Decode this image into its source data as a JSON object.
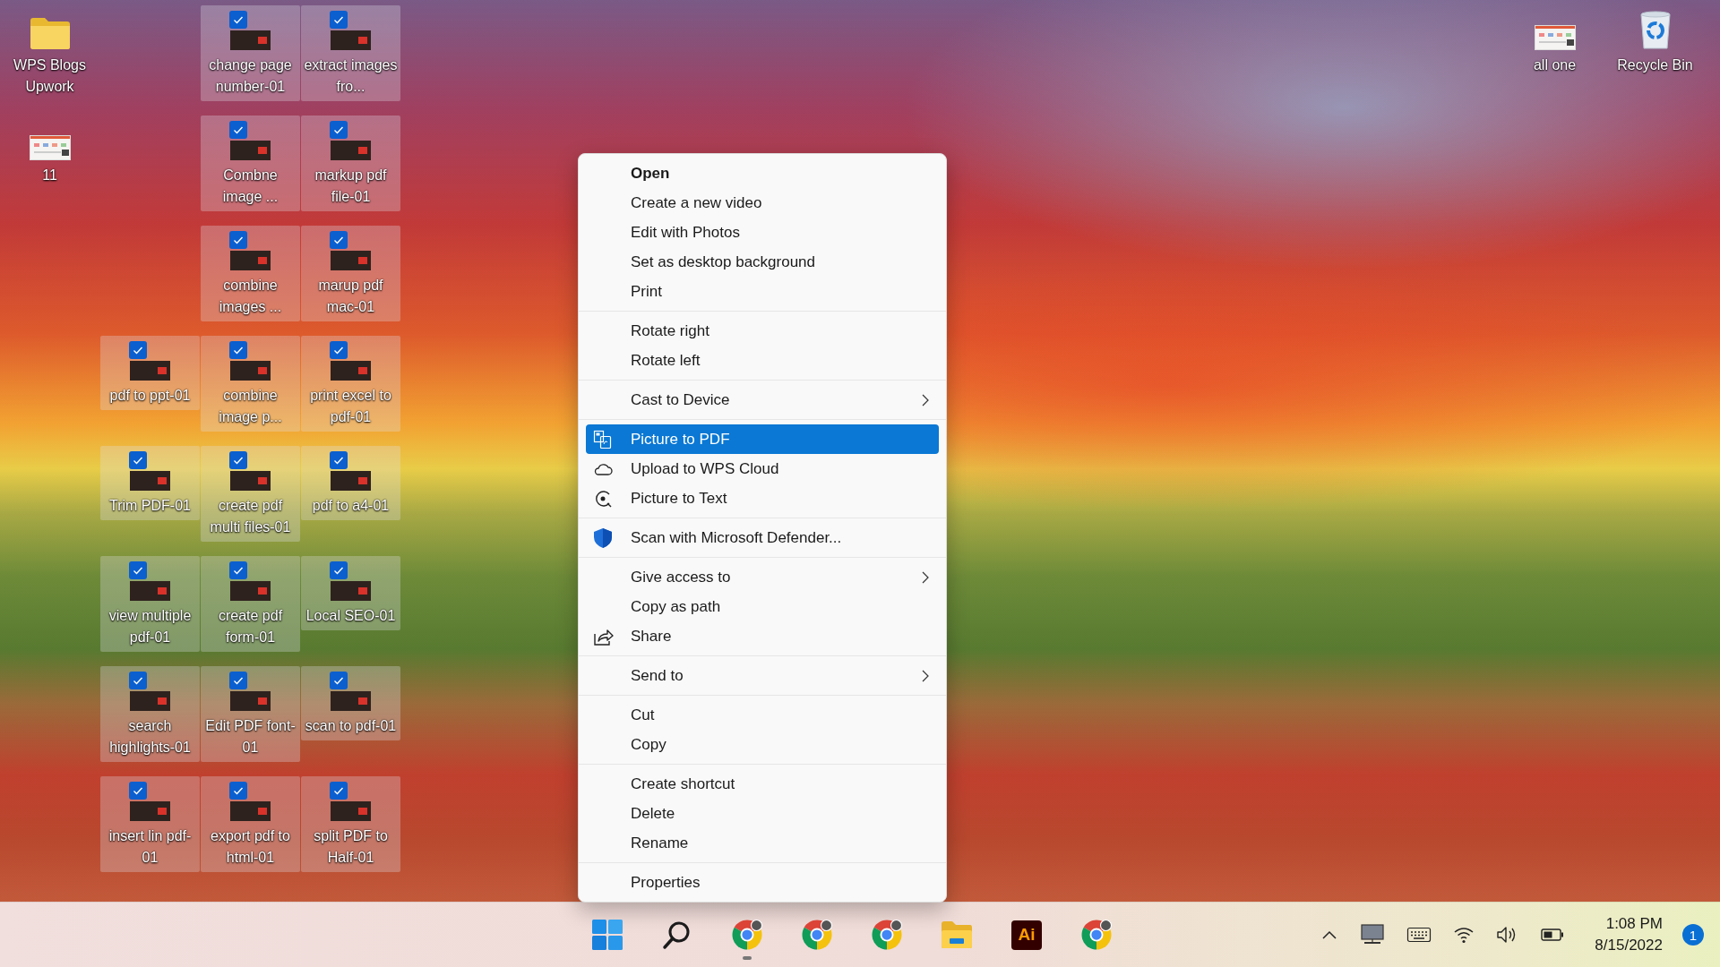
{
  "desktop": {
    "left_column": [
      {
        "label": "WPS Blogs Upwork",
        "kind": "folder",
        "selected": false
      },
      {
        "label": "11",
        "kind": "screenshot",
        "selected": false
      }
    ],
    "columns": [
      [
        {
          "label": "pdf to ppt-01",
          "kind": "image",
          "selected": true
        },
        {
          "label": "Trim PDF-01",
          "kind": "image",
          "selected": true
        },
        {
          "label": "view multiple pdf-01",
          "kind": "image",
          "selected": true
        },
        {
          "label": "search highlights-01",
          "kind": "image",
          "selected": true
        },
        {
          "label": "insert lin pdf-01",
          "kind": "image",
          "selected": true
        }
      ],
      [
        {
          "label": "change page number-01",
          "kind": "image",
          "selected": true
        },
        {
          "label": "Combne image ...",
          "kind": "image",
          "selected": true
        },
        {
          "label": "combine images ...",
          "kind": "image",
          "selected": true
        },
        {
          "label": "combine image p...",
          "kind": "image",
          "selected": true
        },
        {
          "label": "create pdf multi files-01",
          "kind": "image",
          "selected": true
        },
        {
          "label": "create pdf form-01",
          "kind": "image",
          "selected": true
        },
        {
          "label": "Edit PDF font-01",
          "kind": "image",
          "selected": true
        },
        {
          "label": "export pdf to html-01",
          "kind": "image",
          "selected": true
        }
      ],
      [
        {
          "label": "extract images fro...",
          "kind": "image",
          "selected": true
        },
        {
          "label": "markup pdf file-01",
          "kind": "image",
          "selected": true
        },
        {
          "label": "marup pdf mac-01",
          "kind": "image",
          "selected": true
        },
        {
          "label": "print excel to pdf-01",
          "kind": "image",
          "selected": true
        },
        {
          "label": "pdf to a4-01",
          "kind": "image",
          "selected": true
        },
        {
          "label": "Local SEO-01",
          "kind": "image",
          "selected": true
        },
        {
          "label": "scan to pdf-01",
          "kind": "image",
          "selected": true
        },
        {
          "label": "split PDF to Half-01",
          "kind": "image",
          "selected": true
        }
      ]
    ],
    "right_icons": [
      {
        "label": "all one",
        "kind": "screenshot",
        "selected": false
      },
      {
        "label": "Recycle Bin",
        "kind": "recycle-bin",
        "selected": false
      }
    ]
  },
  "context_menu": {
    "groups": [
      [
        {
          "label": "Open",
          "kind": "plain",
          "default": true,
          "submenu": false,
          "selected": false
        },
        {
          "label": "Create a new video",
          "kind": "plain",
          "default": false,
          "submenu": false,
          "selected": false
        },
        {
          "label": "Edit with Photos",
          "kind": "plain",
          "default": false,
          "submenu": false,
          "selected": false
        },
        {
          "label": "Set as desktop background",
          "kind": "plain",
          "default": false,
          "submenu": false,
          "selected": false
        },
        {
          "label": "Print",
          "kind": "plain",
          "default": false,
          "submenu": false,
          "selected": false
        }
      ],
      [
        {
          "label": "Rotate right",
          "kind": "plain",
          "default": false,
          "submenu": false,
          "selected": false
        },
        {
          "label": "Rotate left",
          "kind": "plain",
          "default": false,
          "submenu": false,
          "selected": false
        }
      ],
      [
        {
          "label": "Cast to Device",
          "kind": "plain",
          "default": false,
          "submenu": true,
          "selected": false
        }
      ],
      [
        {
          "label": "Picture to PDF",
          "kind": "picture-pdf",
          "default": false,
          "submenu": false,
          "selected": true
        },
        {
          "label": "Upload to WPS Cloud",
          "kind": "cloud",
          "default": false,
          "submenu": false,
          "selected": false
        },
        {
          "label": "Picture to Text",
          "kind": "scan",
          "default": false,
          "submenu": false,
          "selected": false
        }
      ],
      [
        {
          "label": "Scan with Microsoft Defender...",
          "kind": "shield",
          "default": false,
          "submenu": false,
          "selected": false
        }
      ],
      [
        {
          "label": "Give access to",
          "kind": "plain",
          "default": false,
          "submenu": true,
          "selected": false
        },
        {
          "label": "Copy as path",
          "kind": "plain",
          "default": false,
          "submenu": false,
          "selected": false
        },
        {
          "label": "Share",
          "kind": "share",
          "default": false,
          "submenu": false,
          "selected": false
        }
      ],
      [
        {
          "label": "Send to",
          "kind": "plain",
          "default": false,
          "submenu": true,
          "selected": false
        }
      ],
      [
        {
          "label": "Cut",
          "kind": "plain",
          "default": false,
          "submenu": false,
          "selected": false
        },
        {
          "label": "Copy",
          "kind": "plain",
          "default": false,
          "submenu": false,
          "selected": false
        }
      ],
      [
        {
          "label": "Create shortcut",
          "kind": "plain",
          "default": false,
          "submenu": false,
          "selected": false
        },
        {
          "label": "Delete",
          "kind": "plain",
          "default": false,
          "submenu": false,
          "selected": false
        },
        {
          "label": "Rename",
          "kind": "plain",
          "default": false,
          "submenu": false,
          "selected": false
        }
      ],
      [
        {
          "label": "Properties",
          "kind": "plain",
          "default": false,
          "submenu": false,
          "selected": false
        }
      ]
    ]
  },
  "taskbar": {
    "apps": [
      {
        "kind": "start",
        "running": false
      },
      {
        "kind": "search",
        "running": false
      },
      {
        "kind": "chrome",
        "running": true
      },
      {
        "kind": "chrome",
        "running": false
      },
      {
        "kind": "chrome",
        "running": false
      },
      {
        "kind": "explorer",
        "running": false
      },
      {
        "kind": "illustrator",
        "text": "Ai",
        "running": false
      },
      {
        "kind": "chrome",
        "running": false
      }
    ],
    "tray": [
      {
        "kind": "chevron"
      },
      {
        "kind": "display"
      },
      {
        "kind": "keyboard"
      },
      {
        "kind": "wifi"
      },
      {
        "kind": "volume"
      },
      {
        "kind": "battery"
      }
    ],
    "time": "1:08 PM",
    "date": "8/15/2022",
    "notifications": "1"
  }
}
